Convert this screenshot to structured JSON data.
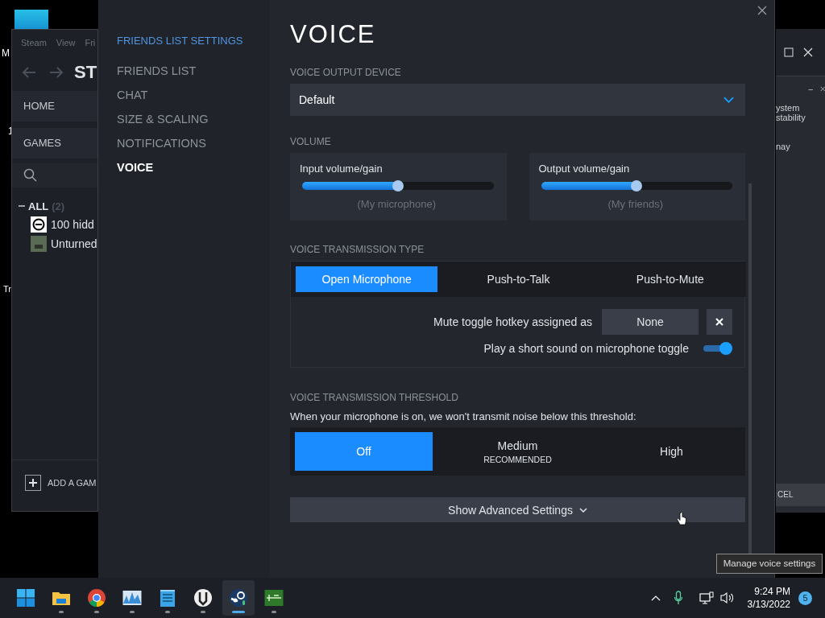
{
  "desktop": {
    "labels": [
      "M",
      "1",
      "Tr"
    ]
  },
  "steam_window": {
    "menu": [
      "Steam",
      "View",
      "Fri"
    ],
    "title": "ST",
    "nav": [
      "HOME",
      "GAMES"
    ],
    "group": {
      "label": "ALL",
      "count": "(2)"
    },
    "games": [
      {
        "kind": "round",
        "name": "100 hidd"
      },
      {
        "kind": "square",
        "name": "Unturned"
      }
    ],
    "add_game": "ADD A GAM"
  },
  "back_window": {
    "lines": [
      "ystem",
      "stability",
      "nay"
    ],
    "button": "CEL"
  },
  "dialog": {
    "sidebar_title": "FRIENDS LIST SETTINGS",
    "sidebar_items": [
      {
        "label": "FRIENDS LIST",
        "selected": false
      },
      {
        "label": "CHAT",
        "selected": false
      },
      {
        "label": "SIZE & SCALING",
        "selected": false
      },
      {
        "label": "NOTIFICATIONS",
        "selected": false
      },
      {
        "label": "VOICE",
        "selected": true
      }
    ],
    "title": "VOICE",
    "output_device": {
      "label": "VOICE OUTPUT DEVICE",
      "value": "Default"
    },
    "volume": {
      "label": "VOLUME",
      "sliders": [
        {
          "label": "Input volume/gain",
          "level": 0.5,
          "caption": "(My microphone)"
        },
        {
          "label": "Output volume/gain",
          "level": 0.5,
          "caption": "(My friends)"
        }
      ]
    },
    "transmission": {
      "label": "VOICE TRANSMISSION TYPE",
      "options": [
        {
          "label": "Open Microphone",
          "selected": true
        },
        {
          "label": "Push-to-Talk",
          "selected": false
        },
        {
          "label": "Push-to-Mute",
          "selected": false
        }
      ],
      "hotkey_label": "Mute toggle hotkey assigned as",
      "hotkey_value": "None",
      "sound_toggle": {
        "label": "Play a short sound on microphone toggle",
        "on": true
      }
    },
    "threshold": {
      "label": "VOICE TRANSMISSION THRESHOLD",
      "description": "When your microphone is on, we won't transmit noise below this threshold:",
      "options": [
        {
          "label": "Off",
          "selected": true
        },
        {
          "label": "Medium",
          "sublabel": "RECOMMENDED",
          "selected": false
        },
        {
          "label": "High",
          "selected": false
        }
      ]
    },
    "advanced_button": "Show Advanced Settings"
  },
  "tooltip": "Manage voice settings",
  "taskbar": {
    "apps": [
      {
        "kind": "start",
        "running": false,
        "active": false
      },
      {
        "kind": "folder",
        "running": true,
        "active": false
      },
      {
        "kind": "browser",
        "running": true,
        "active": false
      },
      {
        "kind": "chart",
        "running": true,
        "active": false
      },
      {
        "kind": "notepad",
        "running": true,
        "active": false
      },
      {
        "kind": "round",
        "running": true,
        "active": false
      },
      {
        "kind": "gear",
        "running": true,
        "active": true
      },
      {
        "kind": "terminal",
        "running": true,
        "active": false
      }
    ],
    "time": "9:24 PM",
    "date": "3/13/2022",
    "notifications": "5"
  }
}
